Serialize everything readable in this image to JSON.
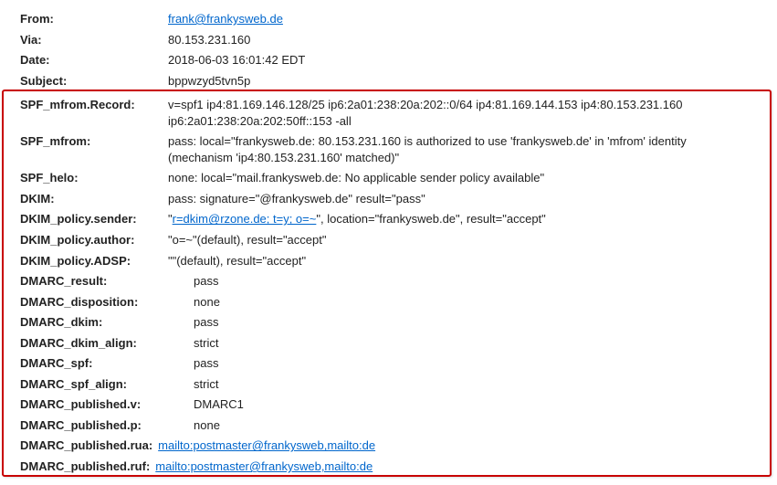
{
  "header": {
    "from_label": "From:",
    "from_value": "frank@frankysweb.de",
    "via_label": "Via:",
    "via_value": "80.153.231.160",
    "date_label": "Date:",
    "date_value": "2018-06-03 16:01:42 EDT",
    "subject_label": "Subject:",
    "subject_value": "bppwzyd5tvn5p"
  },
  "rows": {
    "spf_mfrom_record": {
      "label": "SPF_mfrom.Record:",
      "value": "v=spf1 ip4:81.169.146.128/25 ip6:2a01:238:20a:202::0/64 ip4:81.169.144.153 ip4:80.153.231.160 ip6:2a01:238:20a:202:50ff::153 -all"
    },
    "spf_mfrom": {
      "label": "SPF_mfrom:",
      "value": "pass: local=\"frankysweb.de: 80.153.231.160 is authorized to use 'frankysweb.de' in 'mfrom' identity (mechanism 'ip4:80.153.231.160' matched)\""
    },
    "spf_helo": {
      "label": "SPF_helo:",
      "value": "none: local=\"mail.frankysweb.de: No applicable sender policy available\""
    },
    "dkim": {
      "label": "DKIM:",
      "value": "pass: signature=\"@frankysweb.de\" result=\"pass\""
    },
    "dkim_policy_sender": {
      "label": "DKIM_policy.sender:",
      "prefix": "\"",
      "link": "r=dkim@rzone.de; t=y; o=~",
      "suffix": "\", location=\"frankysweb.de\", result=\"accept\""
    },
    "dkim_policy_author": {
      "label": "DKIM_policy.author:",
      "value": "\"o=~\"(default), result=\"accept\""
    },
    "dkim_policy_adsp": {
      "label": "DKIM_policy.ADSP:",
      "value": "\"\"(default), result=\"accept\""
    },
    "dmarc_result": {
      "label": "DMARC_result:",
      "value": "pass"
    },
    "dmarc_disposition": {
      "label": "DMARC_disposition:",
      "value": "none"
    },
    "dmarc_dkim": {
      "label": "DMARC_dkim:",
      "value": "pass"
    },
    "dmarc_dkim_align": {
      "label": "DMARC_dkim_align:",
      "value": "strict"
    },
    "dmarc_spf": {
      "label": "DMARC_spf:",
      "value": "pass"
    },
    "dmarc_spf_align": {
      "label": "DMARC_spf_align:",
      "value": "strict"
    },
    "dmarc_published_v": {
      "label": "DMARC_published.v:",
      "value": "DMARC1"
    },
    "dmarc_published_p": {
      "label": "DMARC_published.p:",
      "value": "none"
    },
    "dmarc_published_rua": {
      "label": "DMARC_published.rua:",
      "link": "mailto:postmaster@frankysweb,mailto:de"
    },
    "dmarc_published_ruf": {
      "label": "DMARC_published.ruf:",
      "link": "mailto:postmaster@frankysweb,mailto:de"
    }
  }
}
